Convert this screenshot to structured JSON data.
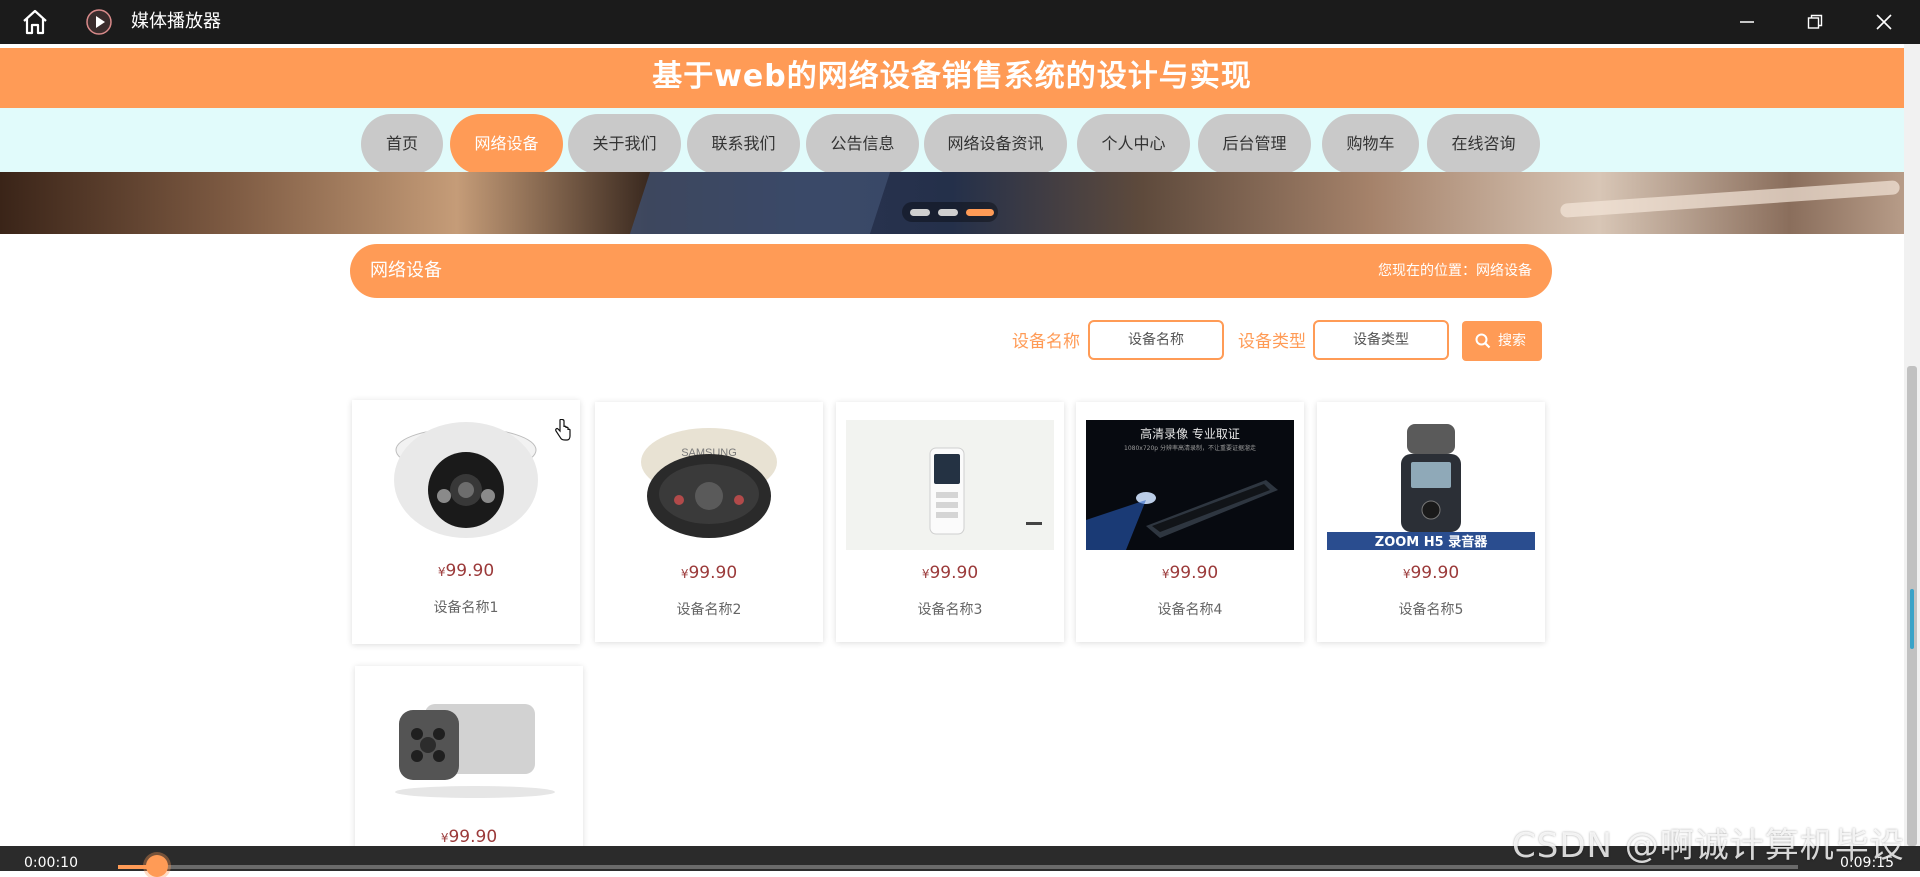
{
  "player": {
    "title": "媒体播放器",
    "elapsed": "0:00:10",
    "duration": "0:09:15",
    "progress": 0.018,
    "watermark": "CSDN @啊诚计算机毕设"
  },
  "site": {
    "header_title": "基于web的网络设备销售系统的设计与实现",
    "nav": [
      {
        "label": "首页",
        "active": false
      },
      {
        "label": "网络设备",
        "active": true
      },
      {
        "label": "关于我们",
        "active": false
      },
      {
        "label": "联系我们",
        "active": false
      },
      {
        "label": "公告信息",
        "active": false
      },
      {
        "label": "网络设备资讯",
        "active": false
      },
      {
        "label": "个人中心",
        "active": false
      },
      {
        "label": "后台管理",
        "active": false
      },
      {
        "label": "购物车",
        "active": false
      },
      {
        "label": "在线咨询",
        "active": false
      }
    ],
    "carousel": {
      "slides": 3,
      "active_slide": 3
    }
  },
  "section": {
    "title": "网络设备",
    "location_label": "您现在的位置：",
    "location_value": "网络设备"
  },
  "search": {
    "name_label": "设备名称",
    "name_placeholder": "设备名称",
    "type_label": "设备类型",
    "type_placeholder": "设备类型",
    "button_label": "搜索"
  },
  "products": [
    {
      "currency": "¥",
      "price": "99.90",
      "name": "设备名称1",
      "image": "dome-camera-white"
    },
    {
      "currency": "¥",
      "price": "99.90",
      "name": "设备名称2",
      "image": "dome-camera-samsung"
    },
    {
      "currency": "¥",
      "price": "99.90",
      "name": "设备名称3",
      "image": "voice-recorder"
    },
    {
      "currency": "¥",
      "price": "99.90",
      "name": "设备名称4",
      "image": "pen-recorder"
    },
    {
      "currency": "¥",
      "price": "99.90",
      "name": "设备名称5",
      "image": "zoom-h5-recorder"
    },
    {
      "currency": "¥",
      "price": "99.90",
      "name": "",
      "image": "bullet-camera"
    }
  ],
  "product_images": {
    "samsung_text": "SAMSUNG",
    "banner4_line1": "高清录像  专业取证",
    "banner4_line2": "1080x720p 分辨率高清录制，不让重要证据溜走",
    "zoom_caption": "ZOOM  H5  录音器"
  },
  "colors": {
    "accent": "#ff9b56",
    "nav_bg": "#e1fbfb",
    "nav_inactive": "#c9c9c9",
    "price": "#9b3a3a"
  }
}
